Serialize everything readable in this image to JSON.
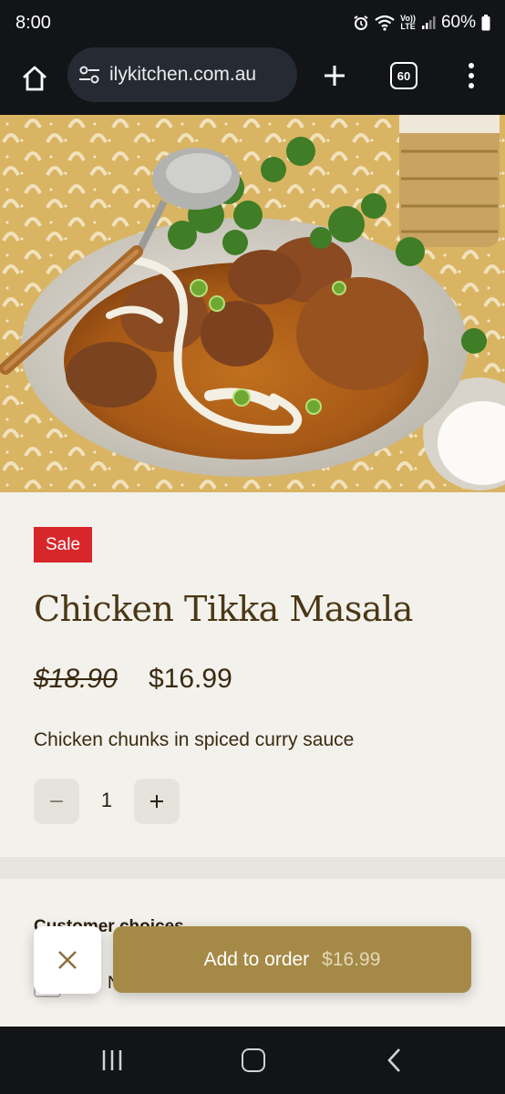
{
  "status": {
    "time": "8:00",
    "battery": "60%",
    "network_badge_top": "Vo))",
    "network_badge_bottom": "LTE"
  },
  "browser": {
    "url": "ilykitchen.com.au",
    "tab_count": "60"
  },
  "product": {
    "sale_badge": "Sale",
    "title": "Chicken Tikka Masala",
    "old_price": "$18.90",
    "new_price": "$16.99",
    "description": "Chicken chunks in spiced curry sauce",
    "quantity": "1"
  },
  "customize": {
    "label": "Customer choices…",
    "option_label": "N"
  },
  "actions": {
    "add_label": "Add to order",
    "add_price": "$16.99"
  },
  "colors": {
    "sale": "#d7272b",
    "brand": "#a58a47",
    "title": "#4a3714",
    "background": "#f3f1ec"
  },
  "icons": [
    "home-icon",
    "tune-icon",
    "plus-icon",
    "tabs-icon",
    "more-vert-icon",
    "minus-icon",
    "close-icon",
    "recents-icon",
    "nav-home-icon",
    "back-icon"
  ]
}
